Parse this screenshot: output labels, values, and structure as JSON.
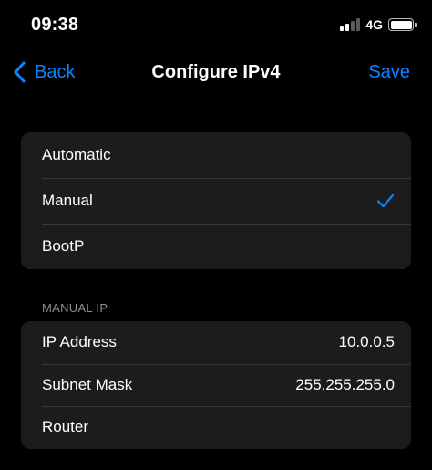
{
  "status": {
    "time": "09:38",
    "network": "4G"
  },
  "nav": {
    "back_label": "Back",
    "title": "Configure IPv4",
    "save_label": "Save"
  },
  "modes": [
    {
      "label": "Automatic",
      "selected": false
    },
    {
      "label": "Manual",
      "selected": true
    },
    {
      "label": "BootP",
      "selected": false
    }
  ],
  "manual_ip": {
    "header": "MANUAL IP",
    "rows": [
      {
        "label": "IP Address",
        "value": "10.0.0.5"
      },
      {
        "label": "Subnet Mask",
        "value": "255.255.255.0"
      },
      {
        "label": "Router",
        "value": ""
      }
    ]
  },
  "colors": {
    "accent": "#0a84ff",
    "background": "#000000",
    "group": "#1c1c1e"
  }
}
